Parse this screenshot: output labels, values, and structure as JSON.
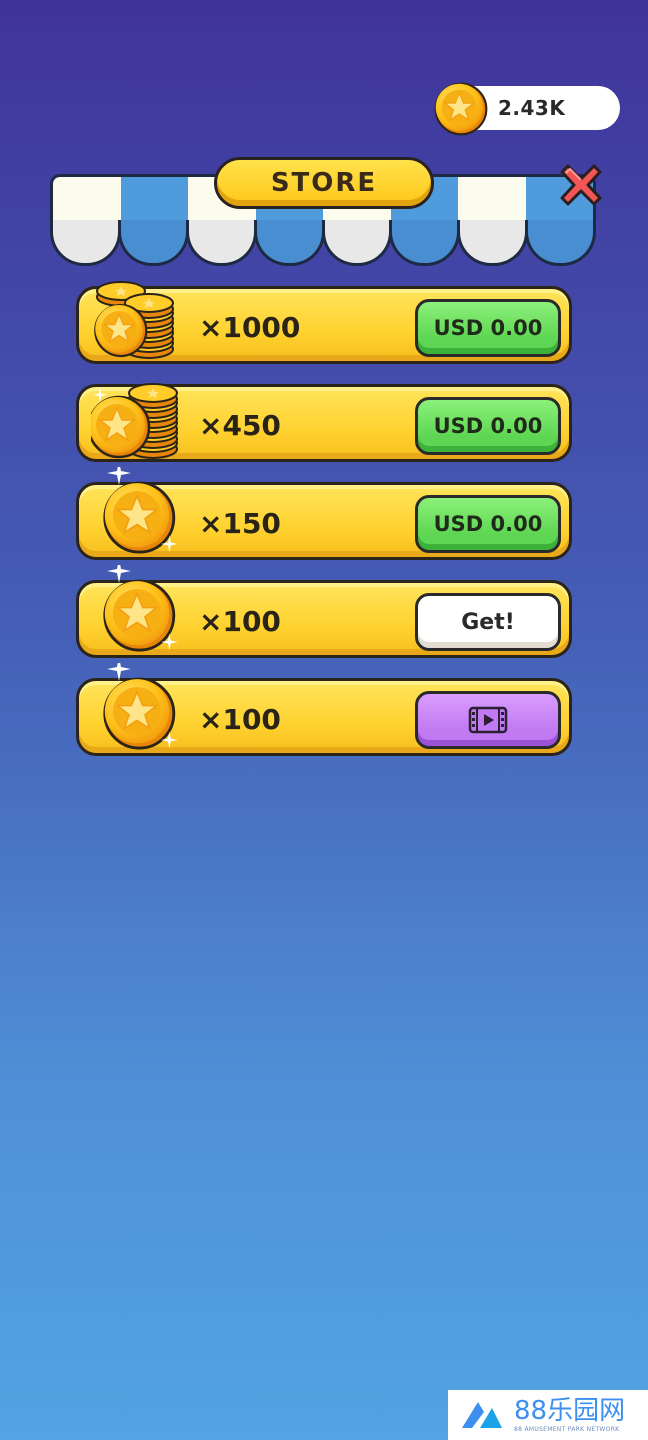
{
  "balance": {
    "value": "2.43K",
    "icon": "coin-star-icon"
  },
  "header": {
    "title": "STORE",
    "close_icon": "close-x-icon"
  },
  "colors": {
    "gold": "#ffd230",
    "green_button": "#5ed653",
    "purple_button": "#c17af2",
    "close_red": "#f25555"
  },
  "offers": [
    {
      "amount": "×1000",
      "icon": "coin-stack-large-icon",
      "button_label": "USD 0.00",
      "button_type": "price"
    },
    {
      "amount": "×450",
      "icon": "coin-stack-medium-icon",
      "button_label": "USD 0.00",
      "button_type": "price"
    },
    {
      "amount": "×150",
      "icon": "single-coin-icon",
      "button_label": "USD 0.00",
      "button_type": "price"
    },
    {
      "amount": "×100",
      "icon": "single-coin-icon",
      "button_label": "Get!",
      "button_type": "free"
    },
    {
      "amount": "×100",
      "icon": "single-coin-icon",
      "button_label": "",
      "button_type": "video-ad",
      "button_icon": "video-play-icon"
    }
  ],
  "watermark": {
    "main": "88乐园网",
    "sub": "88 AMUSEMENT PARK NETWORK"
  }
}
